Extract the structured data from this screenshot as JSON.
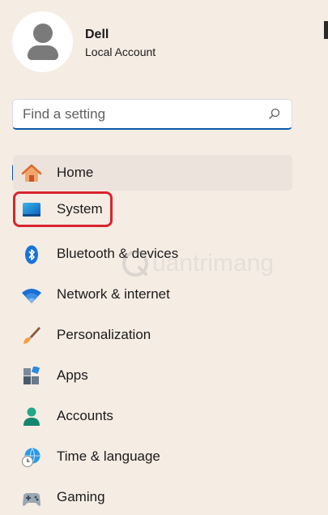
{
  "user": {
    "name": "Dell",
    "account_type": "Local Account"
  },
  "search": {
    "placeholder": "Find a setting",
    "value": ""
  },
  "nav": {
    "items": [
      {
        "label": "Home",
        "icon": "home-icon",
        "selected": true
      },
      {
        "label": "System",
        "icon": "system-monitor-icon",
        "highlighted": true
      },
      {
        "label": "Bluetooth & devices",
        "icon": "bluetooth-icon"
      },
      {
        "label": "Network & internet",
        "icon": "wifi-icon"
      },
      {
        "label": "Personalization",
        "icon": "paintbrush-icon"
      },
      {
        "label": "Apps",
        "icon": "apps-icon"
      },
      {
        "label": "Accounts",
        "icon": "accounts-icon"
      },
      {
        "label": "Time & language",
        "icon": "globe-clock-icon"
      },
      {
        "label": "Gaming",
        "icon": "gamepad-icon"
      }
    ]
  },
  "watermark": {
    "text": "uantrimang"
  },
  "colors": {
    "background": "#f5ece4",
    "accent": "#0a5aa8",
    "highlight_border": "#d9252f"
  }
}
